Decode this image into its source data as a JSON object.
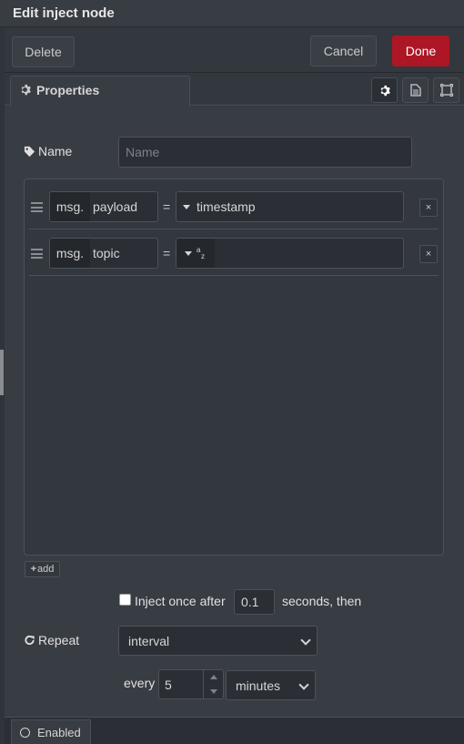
{
  "header": {
    "title": "Edit inject node"
  },
  "toolbar": {
    "delete_label": "Delete",
    "cancel_label": "Cancel",
    "done_label": "Done"
  },
  "tabs": {
    "properties_label": "Properties",
    "active_tab": "properties",
    "icons": [
      "gear-icon",
      "description-icon",
      "appearance-icon"
    ]
  },
  "form": {
    "name_label": "Name",
    "name_placeholder": "Name",
    "name_value": ""
  },
  "props": [
    {
      "prefix": "msg.",
      "key": "payload",
      "equals": "=",
      "type_value": "timestamp",
      "type_icon": "timestamp",
      "remove": "×"
    },
    {
      "prefix": "msg.",
      "key": "topic",
      "equals": "=",
      "type_value": "",
      "type_icon": "string-az-icon",
      "remove": "×"
    }
  ],
  "add_label": "add",
  "inject_once": {
    "checked": false,
    "label": "Inject once after",
    "value": "0.1",
    "suffix": "seconds, then"
  },
  "repeat": {
    "label": "Repeat",
    "mode": "interval",
    "every_label": "every",
    "every_value": "5",
    "units": "minutes"
  },
  "footer": {
    "enabled_label": "Enabled"
  },
  "colors": {
    "done": "#ad1625",
    "background": "#383c43"
  }
}
